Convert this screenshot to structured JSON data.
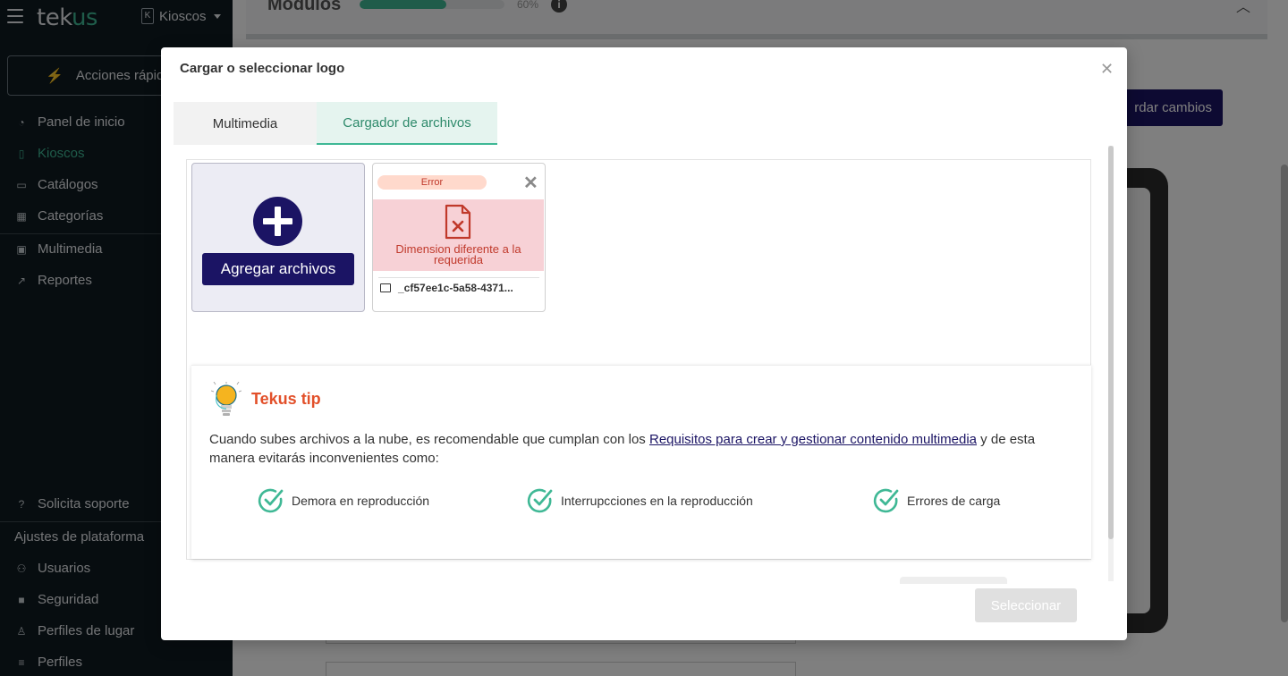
{
  "app": {
    "logo_main": "tek",
    "logo_accent": "us",
    "kiosk_badge": "K",
    "kiosk_selector": "Kioscos"
  },
  "sidebar": {
    "quick_actions": "Acciones rápid",
    "items": [
      {
        "label": "Panel de inicio",
        "icon": "gauge-icon"
      },
      {
        "label": "Kioscos",
        "icon": "kiosk-icon",
        "active": true
      },
      {
        "label": "Catálogos",
        "icon": "book-icon"
      },
      {
        "label": "Categorías",
        "icon": "boxes-icon"
      },
      {
        "label": "Multimedia",
        "icon": "images-icon"
      },
      {
        "label": "Reportes",
        "icon": "chart-line-icon"
      }
    ],
    "support": "Solicita soporte",
    "platform_settings_title": "Ajustes de plataforma",
    "settings_items": [
      {
        "label": "Usuarios",
        "icon": "users-icon"
      },
      {
        "label": "Seguridad",
        "icon": "lock-icon"
      },
      {
        "label": "Perfiles de lugar",
        "icon": "place-icon"
      },
      {
        "label": "Perfiles",
        "icon": "profiles-icon"
      }
    ]
  },
  "background": {
    "section_title": "Modulos",
    "progress_label": "60%",
    "progress_fraction": 0.6,
    "save_button": "rdar cambios"
  },
  "modal": {
    "title": "Cargar o seleccionar logo",
    "tabs": [
      {
        "label": "Multimedia",
        "active": false
      },
      {
        "label": "Cargador de archivos",
        "active": true
      }
    ],
    "add_files_button": "Agregar archivos",
    "file": {
      "status_badge": "Error",
      "error_message": "Dimension diferente a la requerida",
      "name": "_cf57ee1c-5a58-4371..."
    },
    "tip": {
      "title": "Tekus tip",
      "text_before": "Cuando subes archivos a la nube, es recomendable que cumplan con los ",
      "link": "Requisitos para crear y gestionar contenido multimedia",
      "text_after": " y de esta manera evitarás inconvenientes como:",
      "checks": [
        "Demora en reproducción",
        "Interrupcciones en la reproducción",
        "Errores de carga"
      ]
    },
    "select_button": "Seleccionar"
  },
  "colors": {
    "primary": "#1b1464",
    "accent": "#3fb895",
    "tip_title": "#e2502a",
    "error": "#c0392b"
  }
}
